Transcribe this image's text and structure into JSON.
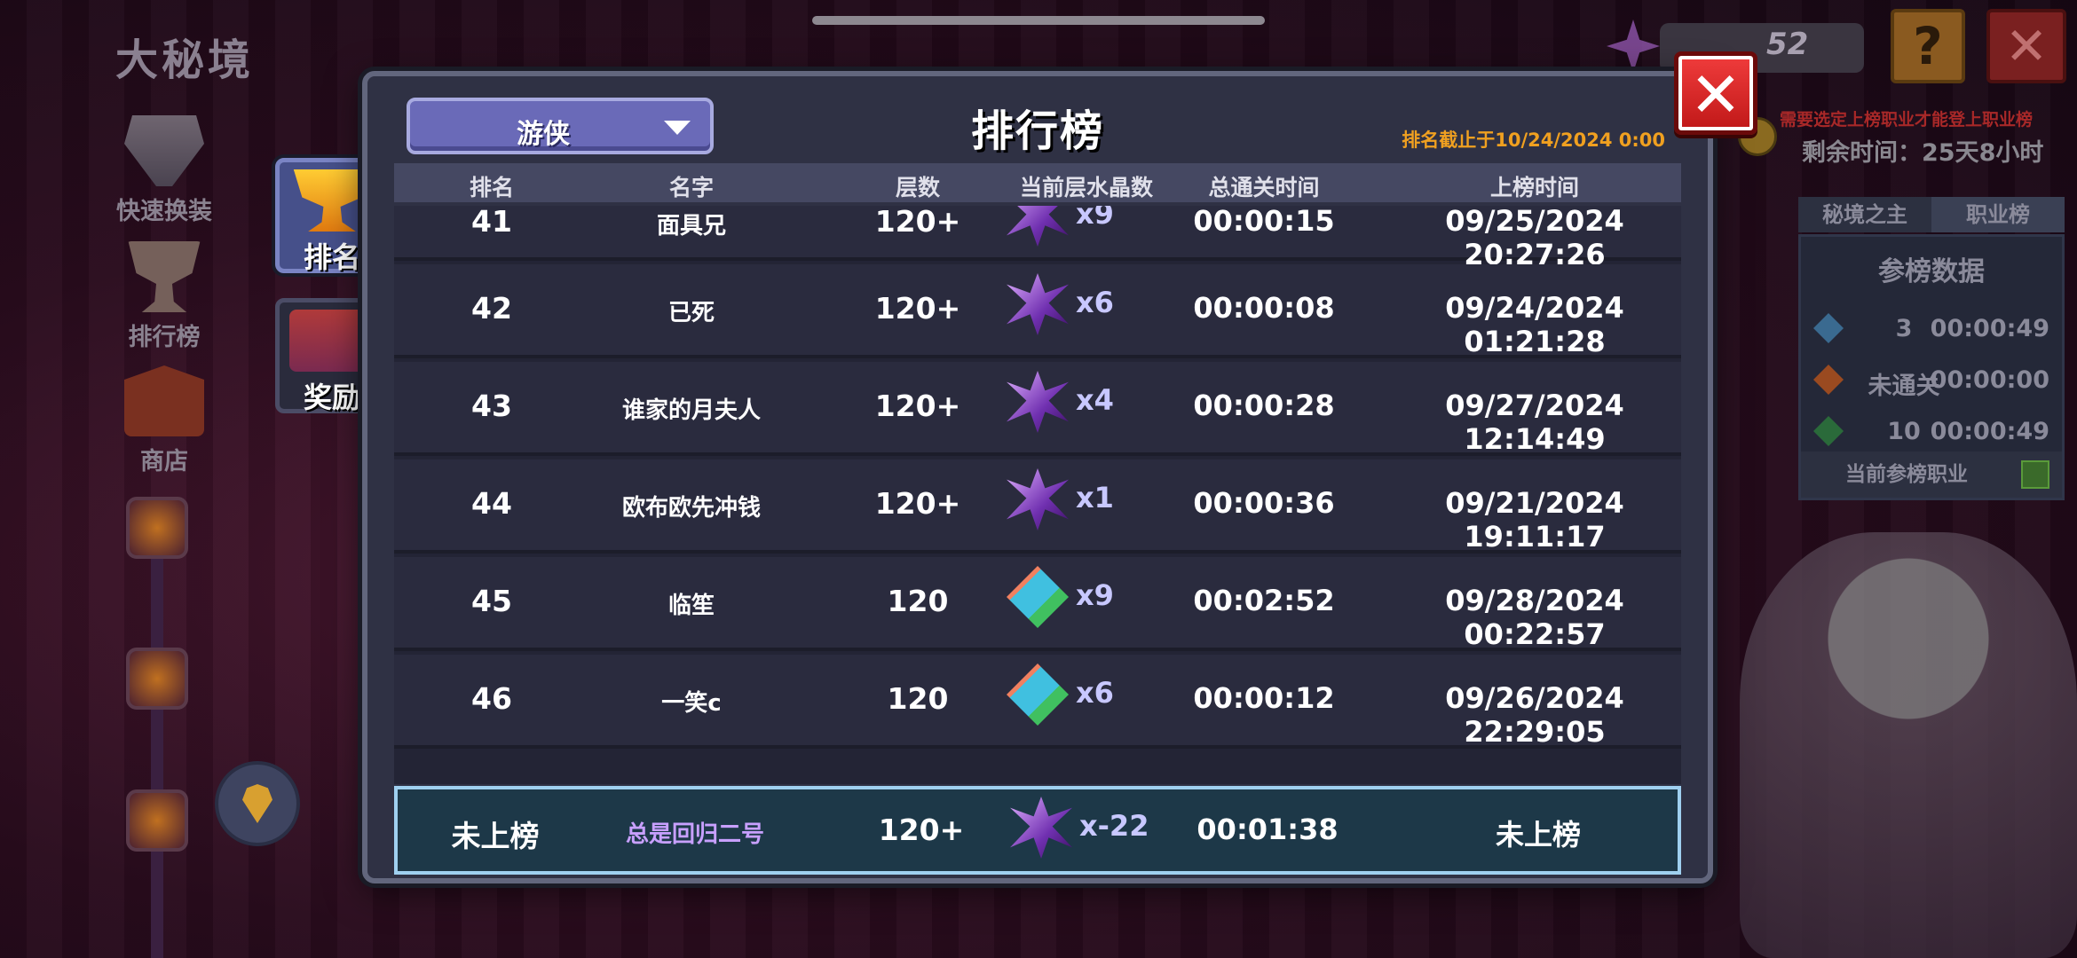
{
  "game_title": "大秘境",
  "side_menu": [
    {
      "label": "快速换装",
      "icon": "swap-equipment-icon"
    },
    {
      "label": "排行榜",
      "icon": "trophy-icon"
    },
    {
      "label": "商店",
      "icon": "shop-icon"
    }
  ],
  "side_tabs": [
    {
      "label": "排名",
      "icon": "trophy-icon",
      "active": true
    },
    {
      "label": "奖励",
      "icon": "chest-icon",
      "active": false
    }
  ],
  "top_right": {
    "currency_value": "52",
    "help_label": "?",
    "close_label": "✕"
  },
  "right_panel": {
    "warning": "需要选定上榜职业才能登上职业榜",
    "remaining": "剩余时间：25天8小时",
    "tabs": [
      "秘境之主",
      "职业榜"
    ],
    "title": "参榜数据",
    "rows": [
      {
        "c1": "3",
        "c2": "00:00:49",
        "color": "#3a6a90"
      },
      {
        "c1": "未通关",
        "c2": "00:00:00",
        "color": "#9a4a20"
      },
      {
        "c1": "10",
        "c2": "00:00:49",
        "color": "#2a6a3a"
      }
    ],
    "footer": "当前参榜职业"
  },
  "modal": {
    "class_select": "游侠",
    "title": "排行榜",
    "cutoff": "排名截止于10/24/2024 0:00",
    "close_label": "✕",
    "headers": [
      "排名",
      "名字",
      "层数",
      "当前层水晶数",
      "总通关时间",
      "上榜时间"
    ],
    "rows": [
      {
        "rank": "41",
        "name": "面具兄",
        "floor": "120+",
        "crystal_type": "purple",
        "crystals": "x9",
        "total": "00:00:15",
        "date": "09/25/2024 20:27:26"
      },
      {
        "rank": "42",
        "name": "已死",
        "floor": "120+",
        "crystal_type": "purple",
        "crystals": "x6",
        "total": "00:00:08",
        "date": "09/24/2024 01:21:28"
      },
      {
        "rank": "43",
        "name": "谁家的月夫人",
        "floor": "120+",
        "crystal_type": "purple",
        "crystals": "x4",
        "total": "00:00:28",
        "date": "09/27/2024 12:14:49"
      },
      {
        "rank": "44",
        "name": "欧布欧先冲钱",
        "floor": "120+",
        "crystal_type": "purple",
        "crystals": "x1",
        "total": "00:00:36",
        "date": "09/21/2024 19:11:17"
      },
      {
        "rank": "45",
        "name": "临笙",
        "floor": "120",
        "crystal_type": "gem",
        "crystals": "x9",
        "total": "00:02:52",
        "date": "09/28/2024 00:22:57"
      },
      {
        "rank": "46",
        "name": "一笑c",
        "floor": "120",
        "crystal_type": "gem",
        "crystals": "x6",
        "total": "00:00:12",
        "date": "09/26/2024 22:29:05"
      }
    ],
    "self_row": {
      "rank": "未上榜",
      "name": "总是回归二号",
      "floor": "120+",
      "crystal_type": "purple",
      "crystals": "x-22",
      "total": "00:01:38",
      "date": "未上榜"
    }
  }
}
